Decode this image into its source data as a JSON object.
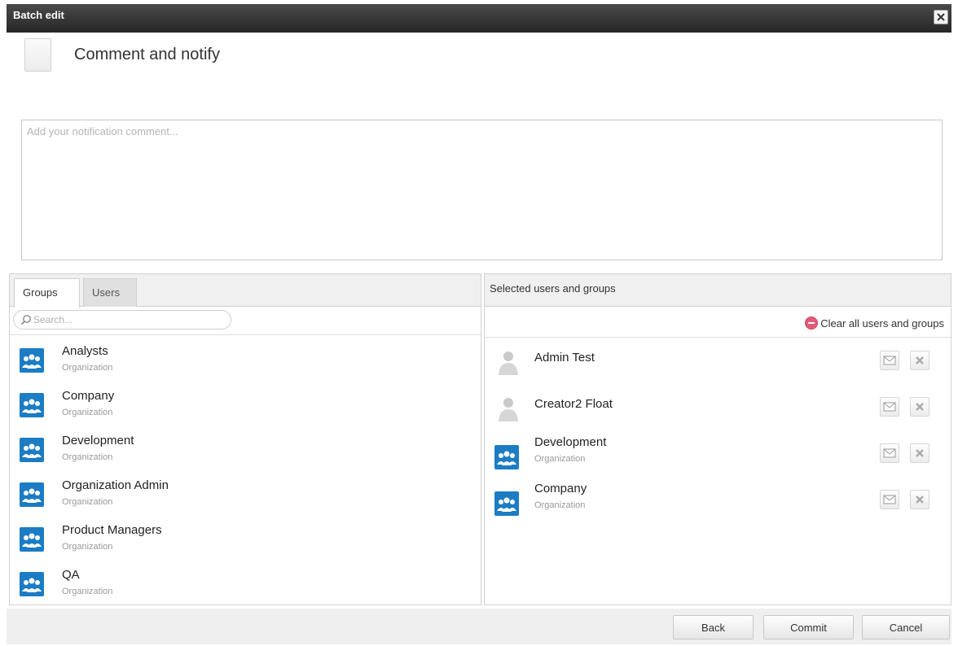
{
  "window": {
    "title": "Batch edit",
    "close_icon": "close-icon"
  },
  "header": {
    "title": "Comment and notify"
  },
  "comment": {
    "placeholder": "Add your notification comment...",
    "value": ""
  },
  "left_panel": {
    "tabs": [
      {
        "label": "Groups",
        "active": true
      },
      {
        "label": "Users",
        "active": false
      }
    ],
    "search_placeholder": "Search...",
    "items": [
      {
        "name": "Analysts",
        "type": "Organization",
        "icon": "group-icon"
      },
      {
        "name": "Company",
        "type": "Organization",
        "icon": "group-icon"
      },
      {
        "name": "Development",
        "type": "Organization",
        "icon": "group-icon"
      },
      {
        "name": "Organization Admin",
        "type": "Organization",
        "icon": "group-icon"
      },
      {
        "name": "Product Managers",
        "type": "Organization",
        "icon": "group-icon"
      },
      {
        "name": "QA",
        "type": "Organization",
        "icon": "group-icon"
      }
    ]
  },
  "right_panel": {
    "title": "Selected users and groups",
    "clear_label": "Clear all users and groups",
    "items": [
      {
        "name": "Admin Test",
        "type": "",
        "icon": "user-icon"
      },
      {
        "name": "Creator2 Float",
        "type": "",
        "icon": "user-icon"
      },
      {
        "name": "Development",
        "type": "Organization",
        "icon": "group-icon"
      },
      {
        "name": "Company",
        "type": "Organization",
        "icon": "group-icon"
      }
    ]
  },
  "footer": {
    "back_label": "Back",
    "commit_label": "Commit",
    "cancel_label": "Cancel"
  },
  "colors": {
    "titlebar": "#2e2e2e",
    "group_icon": "#1c7cc4",
    "clear_icon": "#e45b7a"
  }
}
